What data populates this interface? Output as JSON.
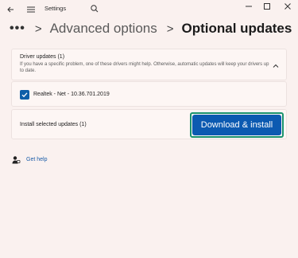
{
  "window": {
    "title": "Settings",
    "controls": {
      "minimize_icon": "minimize-icon",
      "maximize_icon": "maximize-icon",
      "close_icon": "close-icon"
    }
  },
  "nav": {
    "back_icon": "back-arrow-icon",
    "menu_icon": "hamburger-menu-icon",
    "search_icon": "search-icon"
  },
  "breadcrumb": {
    "more": "•••",
    "separator": ">",
    "parent": "Advanced options",
    "current": "Optional updates"
  },
  "drivers": {
    "header_title": "Driver updates (1)",
    "header_description": "If you have a specific problem, one of these drivers might help. Otherwise, automatic updates will keep your drivers up to date.",
    "expanded": true,
    "items": [
      {
        "label": "Realtek - Net - 10.36.701.2019",
        "checked": true
      }
    ]
  },
  "install": {
    "label": "Install selected updates (1)",
    "button_label": "Download & install"
  },
  "help": {
    "label": "Get help",
    "icon": "help-person-icon"
  },
  "colors": {
    "background": "#faf1ef",
    "accent": "#0c5ab1",
    "focus_ring": "#19936e",
    "link": "#1a5ca8"
  }
}
